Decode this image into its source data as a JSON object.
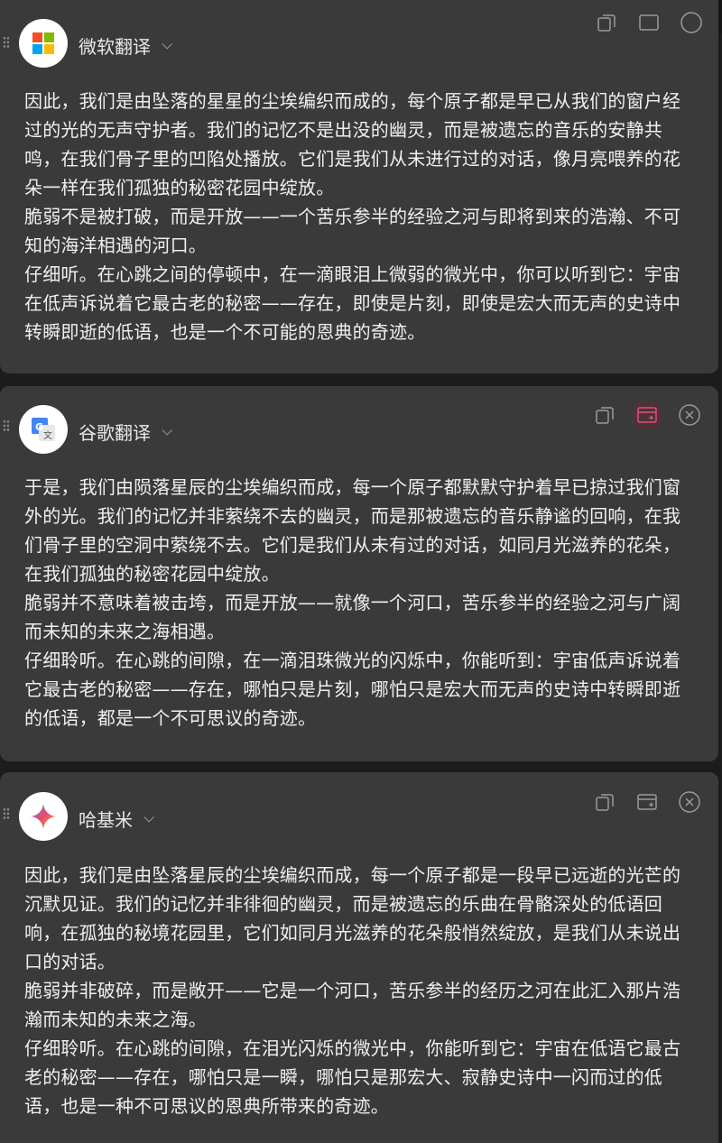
{
  "panels": [
    {
      "name": "微软翻译",
      "text": "因此，我们是由坠落的星星的尘埃编织而成的，每个原子都是早已从我们的窗户经过的光的无声守护者。我们的记忆不是出没的幽灵，而是被遗忘的音乐的安静共鸣，在我们骨子里的凹陷处播放。它们是我们从未进行过的对话，像月亮喂养的花朵一样在我们孤独的秘密花园中绽放。\n脆弱不是被打破，而是开放——一个苦乐参半的经验之河与即将到来的浩瀚、不可知的海洋相遇的河口。\n仔细听。在心跳之间的停顿中，在一滴眼泪上微弱的微光中，你可以听到它：宇宙在低声诉说着它最古老的秘密——存在，即使是片刻，即使是宏大而无声的史诗中转瞬即逝的低语，也是一个不可能的恩典的奇迹。"
    },
    {
      "name": "谷歌翻译",
      "text": "于是，我们由陨落星辰的尘埃编织而成，每一个原子都默默守护着早已掠过我们窗外的光。我们的记忆并非萦绕不去的幽灵，而是那被遗忘的音乐静谧的回响，在我们骨子里的空洞中萦绕不去。它们是我们从未有过的对话，如同月光滋养的花朵，在我们孤独的秘密花园中绽放。\n脆弱并不意味着被击垮，而是开放——就像一个河口，苦乐参半的经验之河与广阔而未知的未来之海相遇。\n仔细聆听。在心跳的间隙，在一滴泪珠微光的闪烁中，你能听到：宇宙低声诉说着它最古老的秘密——存在，哪怕只是片刻，哪怕只是宏大而无声的史诗中转瞬即逝的低语，都是一个不可思议的奇迹。"
    },
    {
      "name": "哈基米",
      "text": "因此，我们是由坠落星辰的尘埃编织而成，每一个原子都是一段早已远逝的光芒的沉默见证。我们的记忆并非徘徊的幽灵，而是被遗忘的乐曲在骨骼深处的低语回响，在孤独的秘境花园里，它们如同月光滋养的花朵般悄然绽放，是我们从未说出口的对话。\n脆弱并非破碎，而是敞开——它是一个河口，苦乐参半的经历之河在此汇入那片浩瀚而未知的未来之海。\n仔细聆听。在心跳的间隙，在泪光闪烁的微光中，你能听到它：宇宙在低语它最古老的秘密——存在，哪怕只是一瞬，哪怕只是那宏大、寂静史诗中一闪而过的低语，也是一种不可思议的恩典所带来的奇迹。"
    }
  ],
  "icons": {
    "copy": "copy-icon",
    "web": "web-translate-icon",
    "close": "close-icon"
  },
  "colors": {
    "card_bg": "#3a3a3a",
    "page_bg": "#1c1c1c",
    "active_tool": "#e0507a"
  }
}
